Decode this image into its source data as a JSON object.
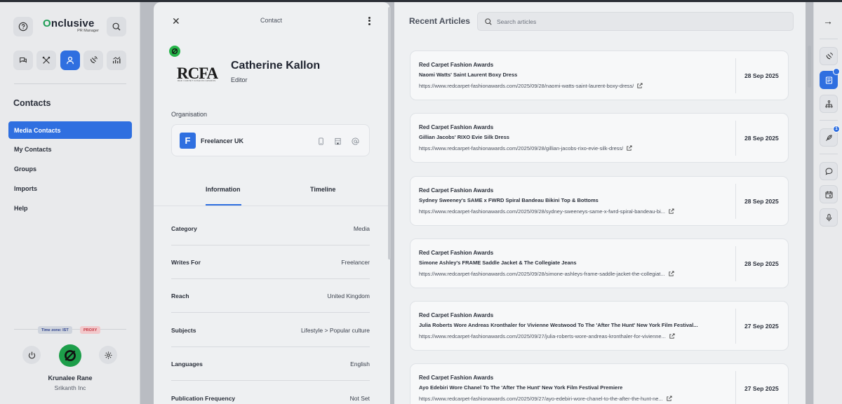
{
  "sidebar": {
    "logo_main": "Onclusive",
    "logo_sub": "PR Manager",
    "section_title": "Contacts",
    "nav": [
      {
        "label": "Media Contacts",
        "active": true
      },
      {
        "label": "My Contacts",
        "active": false
      },
      {
        "label": "Groups",
        "active": false
      },
      {
        "label": "Imports",
        "active": false
      },
      {
        "label": "Help",
        "active": false
      }
    ],
    "timezone_tag": "Time zone: IST",
    "proxy_tag": "PROXY",
    "user_name": "Krunalee Rane",
    "user_org": "Srikanth Inc",
    "icons": [
      "help-icon",
      "search-icon",
      "chat-icon",
      "tools-icon",
      "contacts-icon",
      "satellite-icon",
      "analytics-icon",
      "power-icon",
      "settings-icon"
    ],
    "accent": "#2f6fe0"
  },
  "contact": {
    "header_title": "Contact",
    "logo_text": "RCFA",
    "logo_subtext": "RED CARPET FASHION AWARDS",
    "name": "Catherine Kallon",
    "role": "Editor",
    "org_label": "Organisation",
    "org_initial": "F",
    "org_name": "Freelancer UK",
    "tabs": [
      "Information",
      "Timeline"
    ],
    "info": [
      {
        "label": "Category",
        "value": "Media"
      },
      {
        "label": "Writes For",
        "value": "Freelancer"
      },
      {
        "label": "Reach",
        "value": "United Kingdom"
      },
      {
        "label": "Subjects",
        "value": "Lifestyle > Popular culture"
      },
      {
        "label": "Languages",
        "value": "English"
      },
      {
        "label": "Publication Frequency",
        "value": "Not Set"
      }
    ]
  },
  "articles": {
    "title": "Recent Articles",
    "search_placeholder": "Search articles",
    "items": [
      {
        "publication": "Red Carpet Fashion Awards",
        "headline": "Naomi Watts' Saint Laurent Boxy Dress",
        "url": "https://www.redcarpet-fashionawards.com/2025/09/28/naomi-watts-saint-laurent-boxy-dress/",
        "date": "28 Sep 2025"
      },
      {
        "publication": "Red Carpet Fashion Awards",
        "headline": "Gillian Jacobs' RIXO Evie Silk Dress",
        "url": "https://www.redcarpet-fashionawards.com/2025/09/28/gillian-jacobs-rixo-evie-silk-dress/",
        "date": "28 Sep 2025"
      },
      {
        "publication": "Red Carpet Fashion Awards",
        "headline": "Sydney Sweeney's SAME x FWRD Spiral Bandeau Bikini Top & Bottoms",
        "url": "https://www.redcarpet-fashionawards.com/2025/09/28/sydney-sweeneys-same-x-fwrd-spiral-bandeau-bi...",
        "date": "28 Sep 2025"
      },
      {
        "publication": "Red Carpet Fashion Awards",
        "headline": "Simone Ashley's FRAME Saddle Jacket & The Collegiate Jeans",
        "url": "https://www.redcarpet-fashionawards.com/2025/09/28/simone-ashleys-frame-saddle-jacket-the-collegiat...",
        "date": "28 Sep 2025"
      },
      {
        "publication": "Red Carpet Fashion Awards",
        "headline": "Julia Roberts Wore Andreas Kronthaler for Vivienne Westwood To The 'After The Hunt' New York Film Festival...",
        "url": "https://www.redcarpet-fashionawards.com/2025/09/27/julia-roberts-wore-andreas-kronthaler-for-vivienne...",
        "date": "27 Sep 2025"
      },
      {
        "publication": "Red Carpet Fashion Awards",
        "headline": "Ayo Edebiri Wore Chanel To The 'After The Hunt' New York Film Festival Premiere",
        "url": "https://www.redcarpet-fashionawards.com/2025/09/27/ayo-edebiri-wore-chanel-to-the-after-the-hunt-ne...",
        "date": "27 Sep 2025"
      }
    ]
  },
  "rail": {
    "collapse_icon": "arrow-right-icon",
    "items": [
      {
        "icon": "satellite-icon",
        "badge": ""
      },
      {
        "icon": "news-icon",
        "badge": "dot",
        "active": true
      },
      {
        "icon": "org-chart-icon",
        "badge": ""
      },
      {
        "icon": "feather-icon",
        "badge": "1"
      },
      {
        "icon": "chat-icon",
        "badge": ""
      },
      {
        "icon": "calendar-icon",
        "badge": ""
      },
      {
        "icon": "microphone-icon",
        "badge": ""
      }
    ]
  }
}
